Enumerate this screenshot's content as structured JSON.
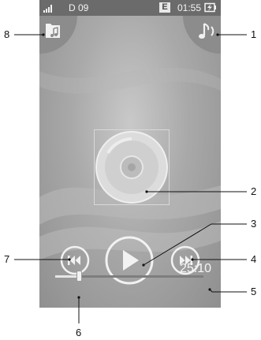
{
  "status_bar": {
    "carrier": "D 09",
    "network_badge": "E",
    "time": "01:55",
    "signal_icon": "signal-bars-icon",
    "battery_icon": "battery-charging-icon"
  },
  "top_buttons": {
    "left_icon": "music-folder-icon",
    "right_icon": "music-notes-icon"
  },
  "album_art_icon": "cd-disc-icon",
  "controls": {
    "previous_icon": "previous-track-icon",
    "play_icon": "play-icon",
    "next_icon": "next-track-icon"
  },
  "playback": {
    "elapsed": "25:10",
    "progress": 0.16
  },
  "callouts": {
    "c1": "1",
    "c2": "2",
    "c3": "3",
    "c4": "4",
    "c5": "5",
    "c6": "6",
    "c7": "7",
    "c8": "8"
  },
  "colors": {
    "screen_bg": "#a9a9a9",
    "status_bar": "#6b6b6b",
    "icon_light": "#f2f2f2",
    "callout_line": "#111111"
  }
}
